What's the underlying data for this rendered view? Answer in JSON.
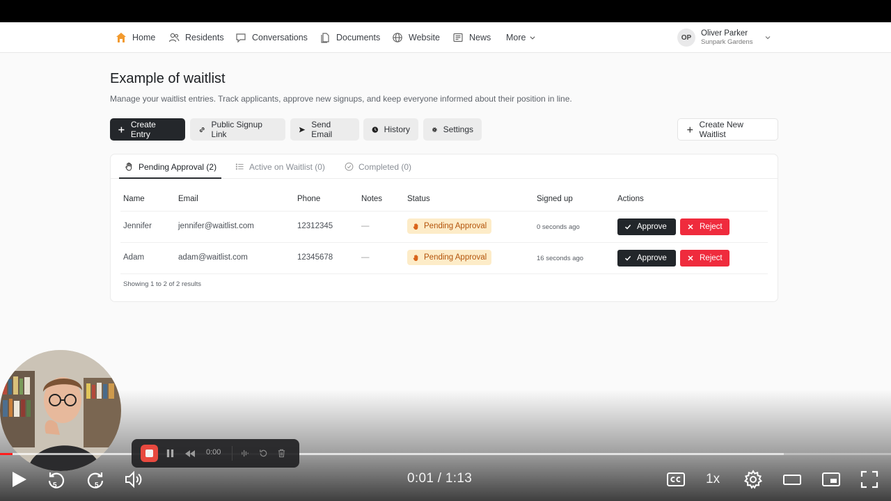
{
  "nav": {
    "items": [
      {
        "label": "Home",
        "icon": "home-icon"
      },
      {
        "label": "Residents",
        "icon": "users-icon"
      },
      {
        "label": "Conversations",
        "icon": "chat-icon"
      },
      {
        "label": "Documents",
        "icon": "documents-icon"
      },
      {
        "label": "Website",
        "icon": "globe-icon"
      },
      {
        "label": "News",
        "icon": "news-icon"
      },
      {
        "label": "More",
        "icon": "chevron-down-icon"
      }
    ],
    "user": {
      "initials": "OP",
      "name": "Oliver Parker",
      "org": "Sunpark Gardens"
    }
  },
  "page": {
    "title": "Example of waitlist",
    "subtitle": "Manage your waitlist entries. Track applicants, approve new signups, and keep everyone informed about their position in line."
  },
  "toolbar": {
    "create_entry": "Create Entry",
    "public_signup_link": "Public Signup Link",
    "send_email": "Send Email",
    "history": "History",
    "settings": "Settings",
    "create_new_waitlist": "Create New Waitlist"
  },
  "tabs": [
    {
      "label": "Pending Approval (2)",
      "active": true
    },
    {
      "label": "Active on Waitlist (0)",
      "active": false
    },
    {
      "label": "Completed (0)",
      "active": false
    }
  ],
  "table": {
    "headers": [
      "Name",
      "Email",
      "Phone",
      "Notes",
      "Status",
      "Signed up",
      "Actions"
    ],
    "rows": [
      {
        "name": "Jennifer",
        "email": "jennifer@waitlist.com",
        "phone": "12312345",
        "notes": "—",
        "status": "Pending Approval",
        "signed_up": "0 seconds ago"
      },
      {
        "name": "Adam",
        "email": "adam@waitlist.com",
        "phone": "12345678",
        "notes": "—",
        "status": "Pending Approval",
        "signed_up": "16 seconds ago"
      }
    ],
    "approve_label": "Approve",
    "reject_label": "Reject",
    "footer": "Showing 1 to 2 of 2 results"
  },
  "recorder": {
    "time": "0:00"
  },
  "player": {
    "current_time": "0:01",
    "duration": "1:13",
    "time_display": "0:01 / 1:13",
    "speed": "1x",
    "progress": 0.014,
    "buffered": 0.88,
    "skip_back_seconds": "5",
    "skip_forward_seconds": "5"
  },
  "colors": {
    "accent": "#f29a2e",
    "dark_button": "#24272b",
    "reject": "#ef2b3d",
    "badge_bg": "#fdecc8",
    "badge_text": "#b3530a",
    "progress": "#ff1c1c"
  }
}
